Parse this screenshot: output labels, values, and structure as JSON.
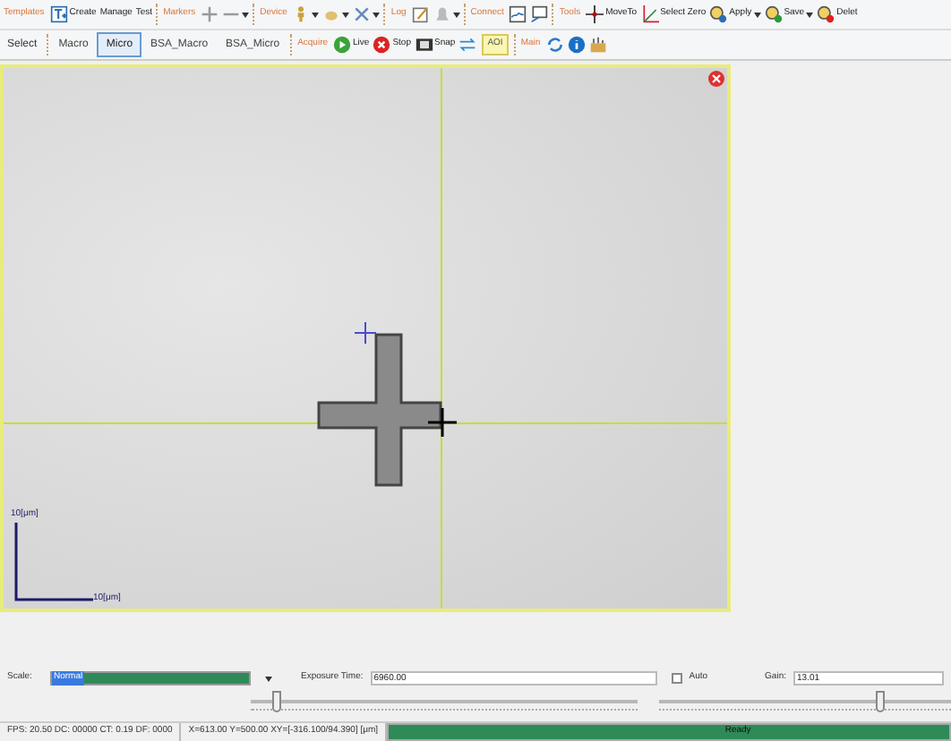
{
  "toolbar_top": {
    "templates": {
      "label": "Templates",
      "create": "Create",
      "manage": "Manage",
      "test": "Test"
    },
    "markers": {
      "label": "Markers"
    },
    "device": {
      "label": "Device"
    },
    "log": {
      "label": "Log"
    },
    "connect": {
      "label": "Connect"
    },
    "tools": {
      "label": "Tools",
      "move_to": "MoveTo",
      "select_zero": "Select Zero",
      "apply": "Apply",
      "save": "Save",
      "delete": "Delet"
    }
  },
  "toolbar_bottom": {
    "select_label": "Select",
    "tabs": [
      {
        "label": "Macro",
        "selected": false
      },
      {
        "label": "Micro",
        "selected": true
      },
      {
        "label": "BSA_Macro",
        "selected": false
      },
      {
        "label": "BSA_Micro",
        "selected": false
      }
    ],
    "acquire_label": "Acquire",
    "live": "Live",
    "stop": "Stop",
    "snap": "Snap",
    "aoi": "AOI",
    "main_label": "Main"
  },
  "image_view": {
    "scale_y": "10[μm]",
    "scale_x": "10[μm]"
  },
  "controls": {
    "scale_label": "Scale:",
    "scale_value": "Normal",
    "exposure_label": "Exposure Time:",
    "exposure_value": "6960.00",
    "auto_label": "Auto",
    "auto_checked": false,
    "gain_label": "Gain:",
    "gain_value": "13.01",
    "exposure_slider": {
      "level": 0.07
    },
    "gain_slider": {
      "level": 0.76
    }
  },
  "status_bar": {
    "stats": "FPS: 20.50 DC: 00000 CT: 0.19 DF: 0000",
    "position": "X=613.00 Y=500.00 XY=[-316.100/94.390] [μm]",
    "progress": {
      "level": 1,
      "text": "Ready"
    }
  }
}
